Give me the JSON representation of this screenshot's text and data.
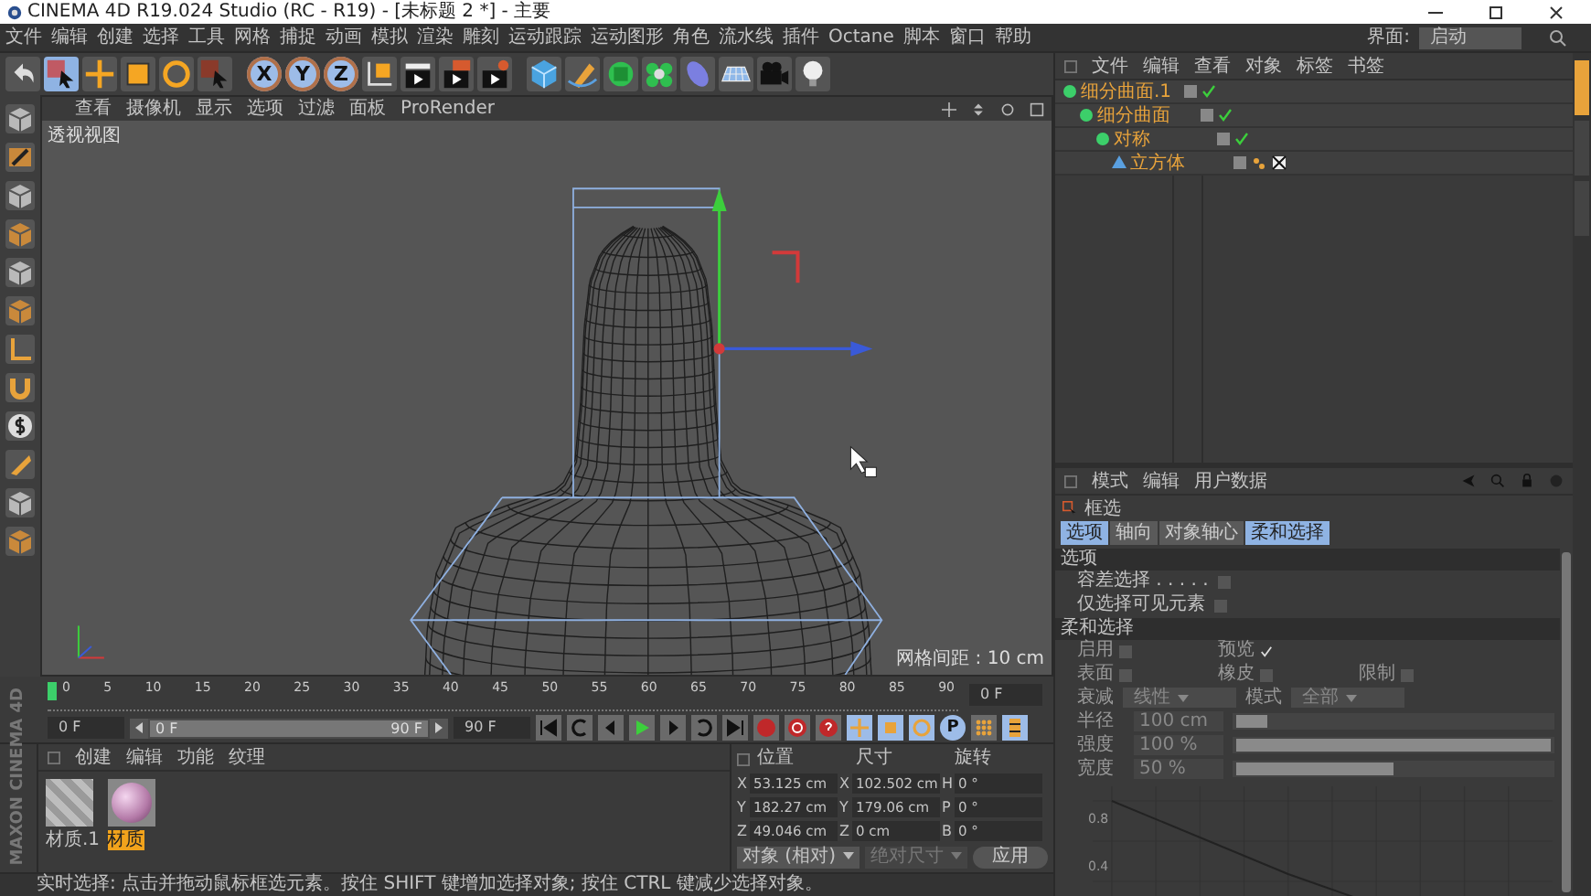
{
  "window": {
    "title": "CINEMA 4D R19.024 Studio (RC - R19) - [未标题 2 *] - 主要"
  },
  "menu_bar": {
    "items": [
      "文件",
      "编辑",
      "创建",
      "选择",
      "工具",
      "网格",
      "捕捉",
      "动画",
      "模拟",
      "渲染",
      "雕刻",
      "运动跟踪",
      "运动图形",
      "角色",
      "流水线",
      "插件",
      "Octane",
      "脚本",
      "窗口",
      "帮助"
    ],
    "layout_label": "界面:",
    "layout_value": "启动"
  },
  "toolbar": {
    "axis_buttons": [
      {
        "label": "X",
        "selected": true
      },
      {
        "label": "Y",
        "selected": true
      },
      {
        "label": "Z",
        "selected": true
      }
    ]
  },
  "viewport": {
    "menu": [
      "查看",
      "摄像机",
      "显示",
      "选项",
      "过滤",
      "面板",
      "ProRender"
    ],
    "view_name": "透视视图",
    "grid_spacing": "网格间距 : 10 cm"
  },
  "timeline": {
    "ticks": [
      "0",
      "5",
      "10",
      "15",
      "20",
      "25",
      "30",
      "35",
      "40",
      "45",
      "50",
      "55",
      "60",
      "65",
      "70",
      "75",
      "80",
      "85",
      "90"
    ],
    "current_frame": "0 F"
  },
  "playback": {
    "start": "0 F",
    "range": {
      "start": "0 F",
      "end": "90 F",
      "level": 1
    },
    "end": "90 F",
    "param_key": "P"
  },
  "brand": "MAXON CINEMA 4D",
  "side_tabs": [
    {
      "selected": true
    },
    {
      "selected": false
    },
    {
      "selected": false
    }
  ],
  "material_manager": {
    "menu": [
      "创建",
      "编辑",
      "功能",
      "纹理"
    ],
    "materials": [
      {
        "name": "材质.1",
        "kind": "striped",
        "selected": false
      },
      {
        "name": "材质",
        "kind": "sphere",
        "selected": true
      }
    ]
  },
  "coordinates": {
    "headers": [
      "位置",
      "尺寸",
      "旋转"
    ],
    "rows": [
      {
        "axes": [
          "X",
          "X",
          "H"
        ],
        "values": [
          "53.125 cm",
          "102.502 cm",
          "0 °"
        ]
      },
      {
        "axes": [
          "Y",
          "Y",
          "P"
        ],
        "values": [
          "182.27 cm",
          "179.06 cm",
          "0 °"
        ]
      },
      {
        "axes": [
          "Z",
          "Z",
          "B"
        ],
        "values": [
          "49.046 cm",
          "0 cm",
          "0 °"
        ]
      }
    ],
    "mode": "对象 (相对)",
    "size_mode": "绝对尺寸",
    "apply": "应用"
  },
  "status_bar": "实时选择: 点击并拖动鼠标框选元素。按住 SHIFT 键增加选择对象; 按住 CTRL 键减少选择对象。",
  "object_manager": {
    "menu": [
      "文件",
      "编辑",
      "查看",
      "对象",
      "标签",
      "书签"
    ],
    "tree": [
      {
        "name": "细分曲面.1",
        "children": [
          {
            "name": "细分曲面",
            "children": [
              {
                "name": "对称",
                "children": [
                  {
                    "name": "立方体"
                  }
                ]
              }
            ]
          }
        ]
      }
    ]
  },
  "attributes": {
    "menu": [
      "模式",
      "编辑",
      "用户数据"
    ],
    "tool_name": "框选",
    "tabs": [
      {
        "label": "选项",
        "selected": true
      },
      {
        "label": "轴向",
        "selected": false
      },
      {
        "label": "对象轴心",
        "selected": false
      },
      {
        "label": "柔和选择",
        "selected": true
      }
    ],
    "options": {
      "title": "选项",
      "checks": [
        {
          "label": "容差选择 . . . . .",
          "checked": false
        },
        {
          "label": "仅选择可见元素",
          "checked": false
        }
      ]
    },
    "soft_selection": {
      "title": "柔和选择",
      "check_rows": [
        {
          "items": [
            {
              "label": "启用",
              "checked": false
            },
            {
              "label": "预览",
              "checked": true
            }
          ]
        },
        {
          "items": [
            {
              "label": "表面",
              "checked": false
            },
            {
              "label": "橡皮",
              "checked": false
            },
            {
              "label": "限制",
              "checked": false
            }
          ]
        }
      ],
      "falloff_label": "衰减",
      "falloff": "线性",
      "mode_label": "模式",
      "mode": "全部",
      "sliders": [
        {
          "label": "半径",
          "value": "100 cm",
          "level": 0.1
        },
        {
          "label": "强度",
          "value": "100 %",
          "level": 1
        },
        {
          "label": "宽度",
          "value": "50 %",
          "level": 0.5
        }
      ],
      "graph_ticks": [
        "0.8",
        "0.4"
      ]
    }
  }
}
